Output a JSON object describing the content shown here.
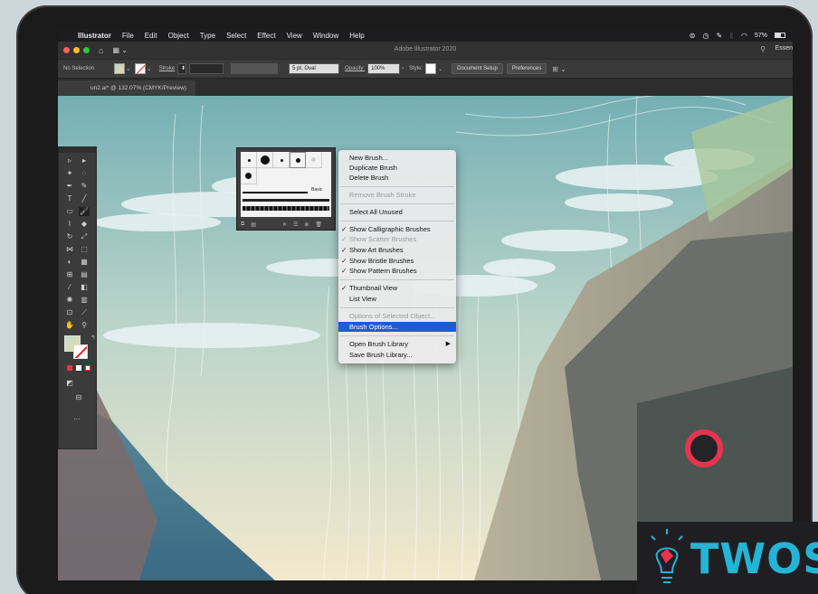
{
  "menubar": {
    "apple": "",
    "app_name": "Illustrator",
    "items": [
      "File",
      "Edit",
      "Object",
      "Type",
      "Select",
      "Effect",
      "View",
      "Window",
      "Help"
    ],
    "battery": "57%"
  },
  "titlebar": {
    "title": "Adobe Illustrator 2020",
    "workspace": "Essen"
  },
  "controlbar": {
    "selection": "No Selection",
    "stroke_label": "Stroke",
    "brush_size": "5 pt. Oval",
    "opacity_label": "Opacity:",
    "opacity_value": "100%",
    "style_label": "Style:",
    "document_setup": "Document Setup",
    "preferences": "Preferences"
  },
  "document_tab": {
    "title": "un2.ai* @ 132.07% (CMYK/Preview)"
  },
  "brushes_panel": {
    "basic_label": "Basic"
  },
  "menu": {
    "items": [
      {
        "label": "New Brush...",
        "state": "normal"
      },
      {
        "label": "Duplicate Brush",
        "state": "normal"
      },
      {
        "label": "Delete Brush",
        "state": "normal"
      },
      {
        "label": "Remove Brush Stroke",
        "state": "disabled"
      },
      {
        "label": "Select All Unused",
        "state": "normal"
      },
      {
        "label": "Show Calligraphic Brushes",
        "state": "checked"
      },
      {
        "label": "Show Scatter Brushes",
        "state": "checked-disabled"
      },
      {
        "label": "Show Art Brushes",
        "state": "checked"
      },
      {
        "label": "Show Bristle Brushes",
        "state": "checked"
      },
      {
        "label": "Show Pattern Brushes",
        "state": "checked"
      },
      {
        "label": "Thumbnail View",
        "state": "checked"
      },
      {
        "label": "List View",
        "state": "normal"
      },
      {
        "label": "Options of Selected Object...",
        "state": "disabled"
      },
      {
        "label": "Brush Options...",
        "state": "highlighted"
      },
      {
        "label": "Open Brush Library",
        "state": "submenu"
      },
      {
        "label": "Save Brush Library...",
        "state": "normal"
      }
    ]
  },
  "watermark": {
    "text": "TWOS",
    "color": "#23b4d6"
  },
  "colors": {
    "highlight": "#1a5fcf",
    "sky_top": "#7fb6b9",
    "sky_bottom": "#f4ead0",
    "record_ring": "#e8344e"
  }
}
